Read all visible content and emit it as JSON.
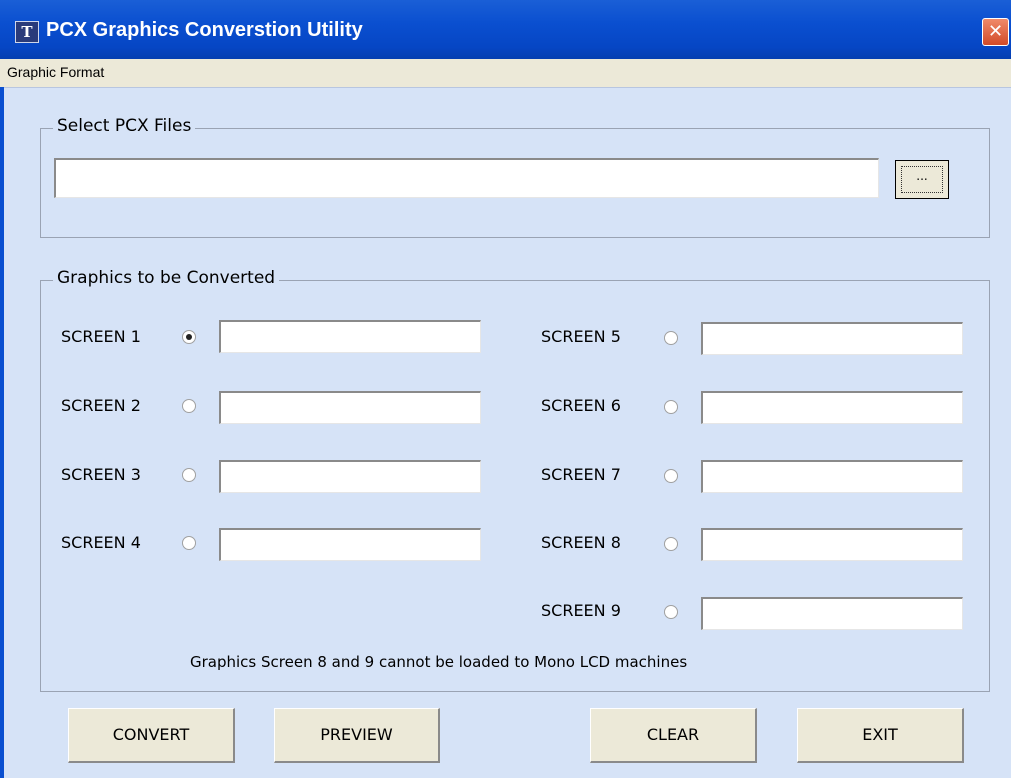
{
  "window": {
    "app_icon_text": "T",
    "title": "PCX Graphics Converstion Utility",
    "close_symbol": "✕"
  },
  "menu": {
    "items": [
      "Graphic Format"
    ]
  },
  "select_files": {
    "group_label": "Select PCX Files",
    "path_value": "",
    "browse_label": "..."
  },
  "graphics": {
    "group_label": "Graphics to be Converted",
    "screens": [
      {
        "label": "SCREEN 1",
        "selected": true,
        "value": ""
      },
      {
        "label": "SCREEN 2",
        "selected": false,
        "value": ""
      },
      {
        "label": "SCREEN 3",
        "selected": false,
        "value": ""
      },
      {
        "label": "SCREEN 4",
        "selected": false,
        "value": ""
      },
      {
        "label": "SCREEN 5",
        "selected": false,
        "value": ""
      },
      {
        "label": "SCREEN 6",
        "selected": false,
        "value": ""
      },
      {
        "label": "SCREEN 7",
        "selected": false,
        "value": ""
      },
      {
        "label": "SCREEN 8",
        "selected": false,
        "value": ""
      },
      {
        "label": "SCREEN 9",
        "selected": false,
        "value": ""
      }
    ],
    "note": "Graphics Screen 8 and 9 cannot be loaded to Mono LCD machines"
  },
  "buttons": {
    "convert": "CONVERT",
    "preview": "PREVIEW",
    "clear": "CLEAR",
    "exit": "EXIT"
  },
  "colors": {
    "titlebar": "#0a4fd0",
    "window_body": "#d6e3f7",
    "button_face": "#ece9d8",
    "close_button": "#d24a28"
  }
}
